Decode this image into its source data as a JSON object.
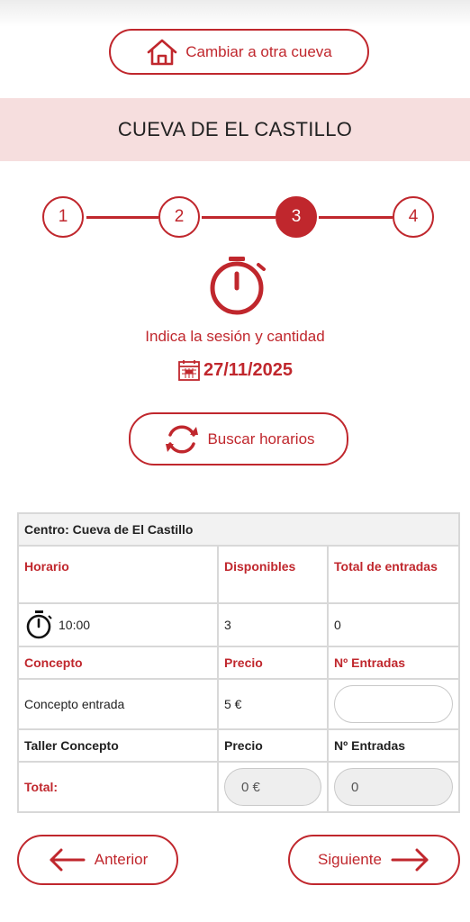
{
  "header": {
    "change_cave_label": "Cambiar a otra cueva",
    "cave_name": "CUEVA DE EL CASTILLO"
  },
  "steps": [
    "1",
    "2",
    "3",
    "4"
  ],
  "current_step": 3,
  "instruction": "Indica la sesión y cantidad",
  "date": "27/11/2025",
  "search_label": "Buscar horarios",
  "table": {
    "center": "Centro: Cueva de El Castillo",
    "schedule_header": [
      "Horario",
      "Disponibles",
      "Total de entradas"
    ],
    "schedule_row": {
      "time": "10:00",
      "available": "3",
      "total": "0"
    },
    "concept_header": [
      "Concepto",
      "Precio",
      "Nº Entradas"
    ],
    "concept_row": {
      "name": "Concepto entrada",
      "price": "5 €"
    },
    "workshop_header": [
      "Taller Concepto",
      "Precio",
      "Nº Entradas"
    ],
    "total_row": {
      "label": "Total:",
      "price": "0 €",
      "count": "0"
    }
  },
  "nav": {
    "prev_label": "Anterior",
    "next_label": "Siguiente"
  },
  "colors": {
    "accent": "#c0272d",
    "band": "#f6dede"
  },
  "icons": [
    "house-icon",
    "stopwatch-icon",
    "calendar-icon",
    "refresh-icon",
    "arrow-left-icon",
    "arrow-right-icon"
  ]
}
